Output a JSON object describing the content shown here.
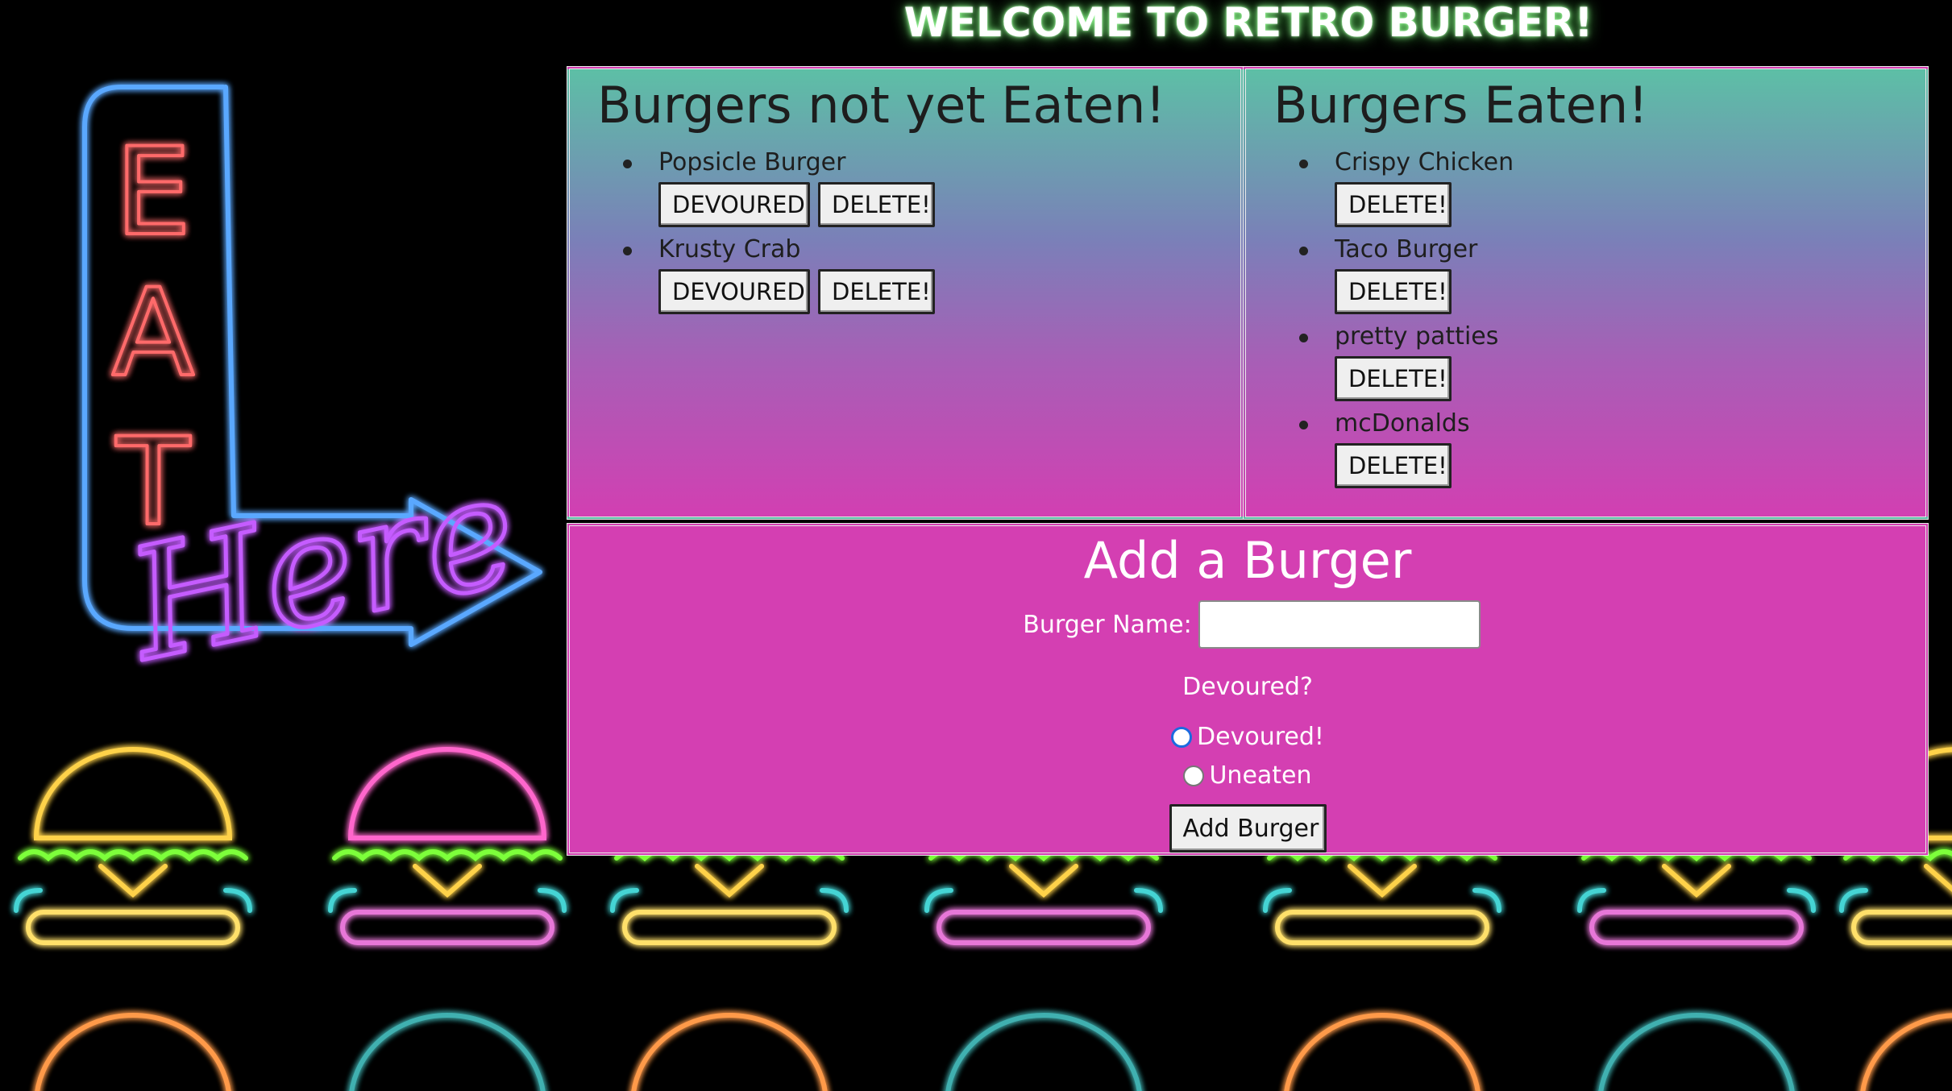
{
  "page": {
    "title": "WELCOME TO RETRO BURGER!"
  },
  "not_eaten": {
    "heading": "Burgers not yet Eaten!",
    "items": [
      {
        "name": "Popsicle Burger",
        "devour_label": "DEVOURED",
        "delete_label": "DELETE!"
      },
      {
        "name": "Krusty Crab",
        "devour_label": "DEVOURED",
        "delete_label": "DELETE!"
      }
    ]
  },
  "eaten": {
    "heading": "Burgers Eaten!",
    "items": [
      {
        "name": "Crispy Chicken",
        "delete_label": "DELETE!"
      },
      {
        "name": "Taco Burger",
        "delete_label": "DELETE!"
      },
      {
        "name": "pretty patties",
        "delete_label": "DELETE!"
      },
      {
        "name": "mcDonalds",
        "delete_label": "DELETE!"
      }
    ]
  },
  "add_form": {
    "heading": "Add a Burger",
    "name_label": "Burger Name:",
    "name_value": "",
    "devoured_question": "Devoured?",
    "options": [
      {
        "label": "Devoured!",
        "checked": true
      },
      {
        "label": "Uneaten",
        "checked": false
      }
    ],
    "submit_label": "Add Burger"
  },
  "background": {
    "sign_letters": [
      "E",
      "A",
      "T"
    ],
    "sign_script": "Here",
    "neon_colors": [
      "#ffd24a",
      "#ff66cc",
      "#ffe06a",
      "#e777d8",
      "#ffd24a",
      "#ff66cc"
    ],
    "neon_arrow_color": "#5aa8ff",
    "neon_letter_color": "#ff6b6b",
    "neon_script_color": "#c55cff"
  }
}
